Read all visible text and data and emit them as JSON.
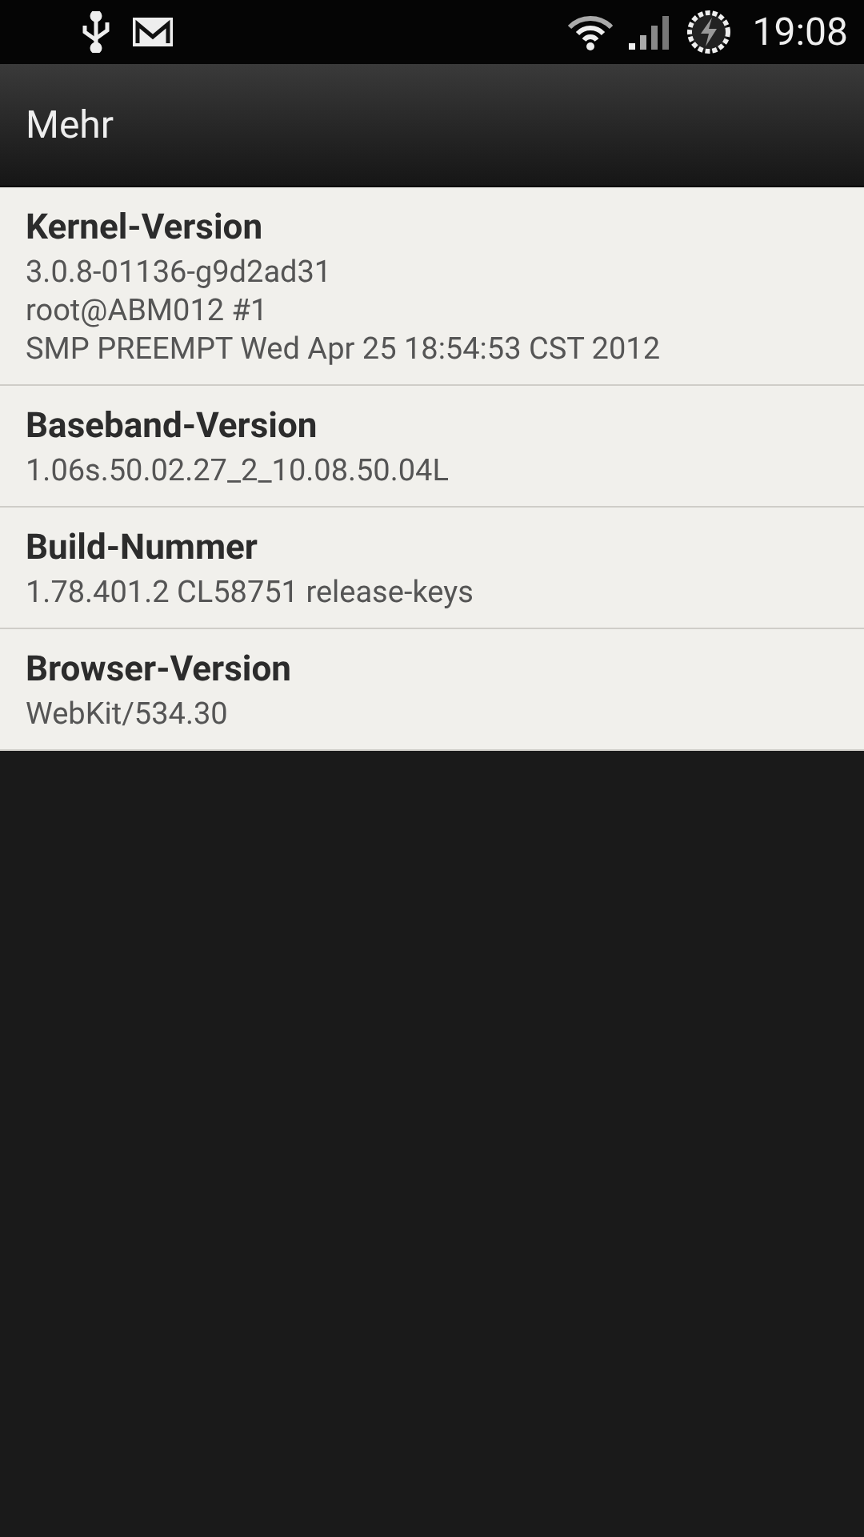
{
  "status_bar": {
    "time": "19:08"
  },
  "header": {
    "title": "Mehr"
  },
  "items": [
    {
      "title": "Kernel-Version",
      "lines": [
        "3.0.8-01136-g9d2ad31",
        "root@ABM012 #1",
        "SMP PREEMPT Wed Apr 25 18:54:53 CST 2012"
      ]
    },
    {
      "title": "Baseband-Version",
      "lines": [
        "1.06s.50.02.27_2_10.08.50.04L"
      ]
    },
    {
      "title": "Build-Nummer",
      "lines": [
        "1.78.401.2 CL58751 release-keys"
      ]
    },
    {
      "title": "Browser-Version",
      "lines": [
        "WebKit/534.30"
      ]
    }
  ]
}
